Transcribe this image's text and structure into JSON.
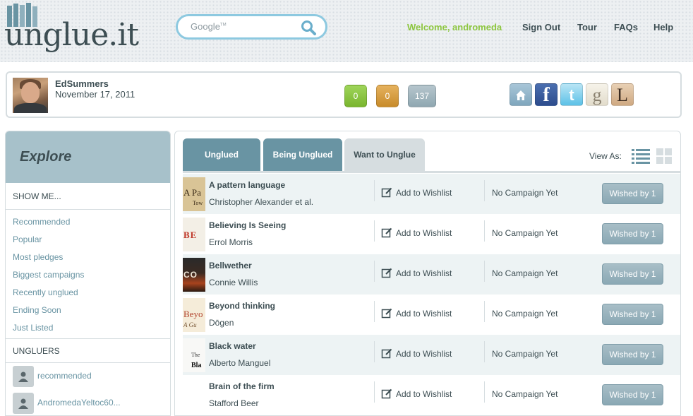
{
  "header": {
    "logo_text": "unglue.it",
    "search_placeholder": "Google",
    "search_mark": "TM",
    "nav": {
      "welcome": "Welcome, andromeda",
      "sign_out": "Sign Out",
      "tour": "Tour",
      "faqs": "FAQs",
      "help": "Help"
    }
  },
  "profile": {
    "name": "EdSummers",
    "date": "November 17, 2011",
    "badges": {
      "green": "0",
      "orange": "0",
      "gray": "137"
    },
    "social": {
      "facebook": "f",
      "twitter": "t",
      "goodreads": "g",
      "librarything": "L"
    }
  },
  "sidebar": {
    "explore": "Explore",
    "show_me": "SHOW ME...",
    "links": [
      "Recommended",
      "Popular",
      "Most pledges",
      "Biggest campaigns",
      "Recently unglued",
      "Ending Soon",
      "Just Listed"
    ],
    "ungluers_head": "UNGLUERS",
    "ungluers": [
      "recommended",
      "AndromedaYeltoc60..."
    ]
  },
  "main": {
    "tabs": [
      "Unglued",
      "Being Unglued",
      "Want to Unglue"
    ],
    "view_as": "View As:",
    "add_label": "Add to Wishlist",
    "campaign_label": "No Campaign Yet",
    "books": [
      {
        "title": "A pattern language",
        "author": "Christopher Alexander et al.",
        "cover_text": "A Pa",
        "cover_sub": "Tow",
        "wished": "Wished by 1"
      },
      {
        "title": "Believing Is Seeing",
        "author": "Errol Morris",
        "cover_text": "BE",
        "cover_sub": "",
        "wished": "Wished by 1"
      },
      {
        "title": "Bellwether",
        "author": "Connie Willis",
        "cover_text": "CO",
        "cover_sub": "",
        "wished": "Wished by 1"
      },
      {
        "title": "Beyond thinking",
        "author": "Dōgen",
        "cover_text": "Beyo",
        "cover_sub": "A Gu",
        "wished": "Wished by 1"
      },
      {
        "title": "Black water",
        "author": "Alberto Manguel",
        "cover_text": "The",
        "cover_sub": "Bla",
        "wished": "Wished by 1"
      },
      {
        "title": "Brain of the firm",
        "author": "Stafford Beer",
        "cover_text": "",
        "cover_sub": "",
        "wished": "Wished by 1"
      }
    ]
  },
  "colors": {
    "accent_green": "#8dc63f",
    "text_dark": "#3d4e53",
    "link_blue": "#6994a3",
    "tab_active": "#6994a3",
    "explore_bg": "#a7c1ca"
  }
}
